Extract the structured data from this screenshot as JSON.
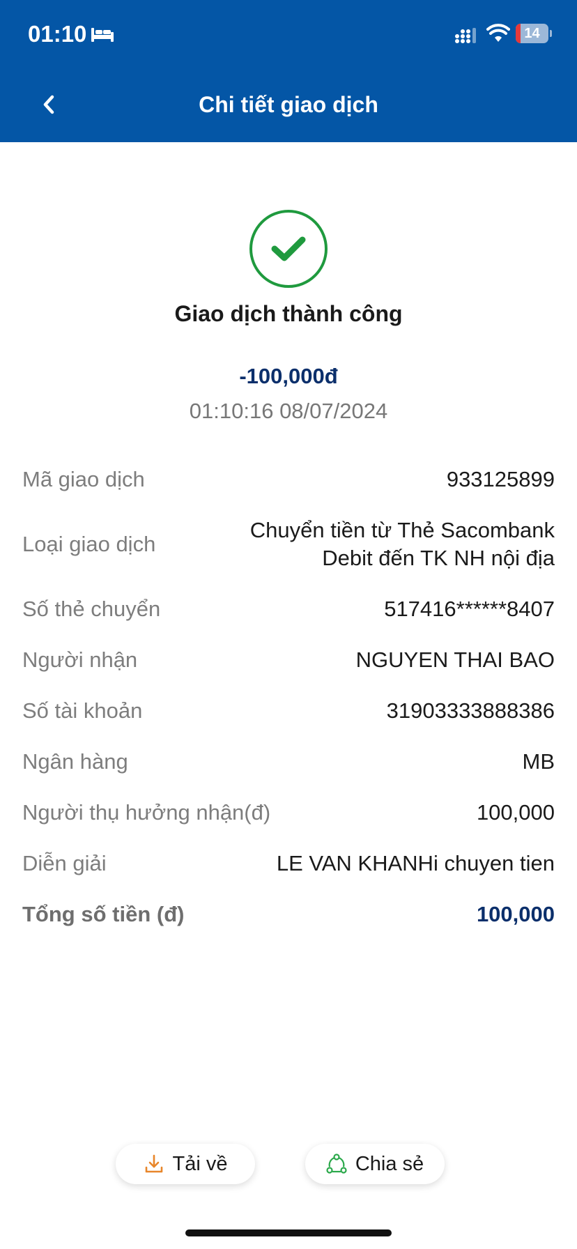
{
  "status_bar": {
    "time": "01:10",
    "battery_level": "14",
    "battery_fraction": 0.14,
    "icons": [
      "bed-icon",
      "signal-icon",
      "wifi-icon",
      "battery-icon"
    ]
  },
  "nav": {
    "title": "Chi tiết giao dịch",
    "back_icon": "chevron-left-icon"
  },
  "summary": {
    "status_icon": "success-check-icon",
    "status_text": "Giao dịch thành công",
    "amount": "-100,000đ",
    "datetime": "01:10:16 08/07/2024"
  },
  "details": [
    {
      "label": "Mã giao dịch",
      "value": "933125899"
    },
    {
      "label": "Loại giao dịch",
      "value_line1": "Chuyển tiền từ Thẻ Sacombank",
      "value_line2": "Debit đến TK NH nội địa"
    },
    {
      "label": "Số thẻ chuyển",
      "value": "517416******8407"
    },
    {
      "label": "Người nhận",
      "value": "NGUYEN THAI BAO"
    },
    {
      "label": "Số tài khoản",
      "value": "31903333888386"
    },
    {
      "label": "Ngân hàng",
      "value": "MB"
    },
    {
      "label": "Người thụ hưởng nhận(đ)",
      "value": "100,000"
    },
    {
      "label": "Diễn giải",
      "value": "LE VAN KHANHi chuyen tien"
    },
    {
      "label": "Tổng số tiền (đ)",
      "value": "100,000"
    }
  ],
  "actions": {
    "download_label": "Tải về",
    "share_label": "Chia sẻ"
  },
  "colors": {
    "header": "#0456a6",
    "success": "#1f9a3e",
    "amount": "#0b2f6b",
    "download_icon": "#e8862a",
    "share_icon": "#2aa84a"
  }
}
